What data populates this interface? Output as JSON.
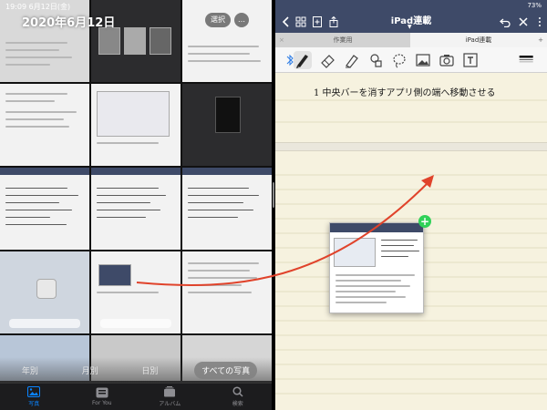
{
  "status_bar": {
    "time_date": "19:09   6月12日(金)",
    "battery": "73%"
  },
  "photos": {
    "title": "2020年6月12日",
    "select_label": "選択",
    "more_label": "…",
    "segments": [
      "年別",
      "月別",
      "日別",
      "すべての写真"
    ],
    "active_segment": "すべての写真",
    "tabs": [
      {
        "label": "写真",
        "icon": "photo-library-icon",
        "active": true
      },
      {
        "label": "For You",
        "icon": "for-you-icon",
        "active": false
      },
      {
        "label": "アルバム",
        "icon": "albums-icon",
        "active": false
      },
      {
        "label": "検索",
        "icon": "search-icon",
        "active": false
      }
    ]
  },
  "notes": {
    "title": "iPad連載",
    "doc_tabs": [
      {
        "label": "作業用"
      },
      {
        "label": "iPad連載"
      }
    ],
    "handwriting_line": "1   中央バーを消すアプリ側の端へ移動させる",
    "tools": [
      "pen-tool-icon",
      "eraser-icon",
      "highlighter-icon",
      "shapes-icon",
      "lasso-icon",
      "image-icon",
      "camera-icon",
      "text-icon"
    ],
    "drag_badge": "+"
  },
  "colors": {
    "nav_bar": "#3e4a68",
    "paper": "#f6f2df",
    "arrow": "#e0432b",
    "accent_blue": "#0a84ff",
    "badge_green": "#30d158"
  }
}
